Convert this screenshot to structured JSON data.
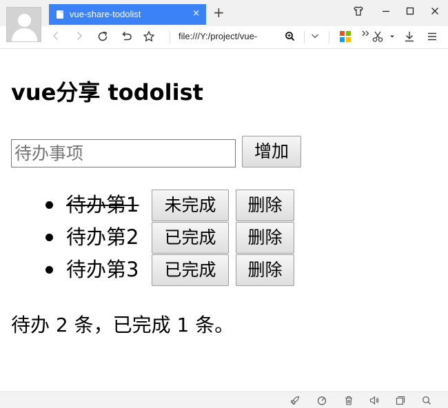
{
  "browser": {
    "tab_title": "vue-share-todolist",
    "tab_close": "×",
    "new_tab": "+",
    "url": "file:///Y:/project/vue-"
  },
  "page": {
    "heading": "vue分享 todolist",
    "input": {
      "placeholder": "待办事项",
      "value": ""
    },
    "add_button": "增加",
    "todos": [
      {
        "text": "待办第1",
        "done": true,
        "status_label": "未完成",
        "delete_label": "删除"
      },
      {
        "text": "待办第2",
        "done": false,
        "status_label": "已完成",
        "delete_label": "删除"
      },
      {
        "text": "待办第3",
        "done": false,
        "status_label": "已完成",
        "delete_label": "删除"
      }
    ],
    "summary": "待办 2 条，已完成 1 条。"
  },
  "colors": {
    "tab_active": "#3b82f6",
    "tile_red": "#f25022",
    "tile_green": "#7fba00",
    "tile_blue": "#00a4ef",
    "tile_yellow": "#ffb900"
  },
  "icons": {
    "toolbar": [
      "back-icon",
      "forward-icon",
      "reload-icon",
      "undo-icon",
      "star-icon",
      "zoom-icon",
      "chevron-down-icon",
      "apps-icon",
      "more-icon",
      "scissors-icon",
      "download-icon",
      "menu-icon"
    ],
    "window": [
      "shirt-icon",
      "minimize-icon",
      "maximize-icon",
      "close-icon"
    ],
    "statusbar": [
      "rocket-icon",
      "speed-icon",
      "trash-icon",
      "speaker-icon",
      "window-icon",
      "search-icon"
    ]
  }
}
